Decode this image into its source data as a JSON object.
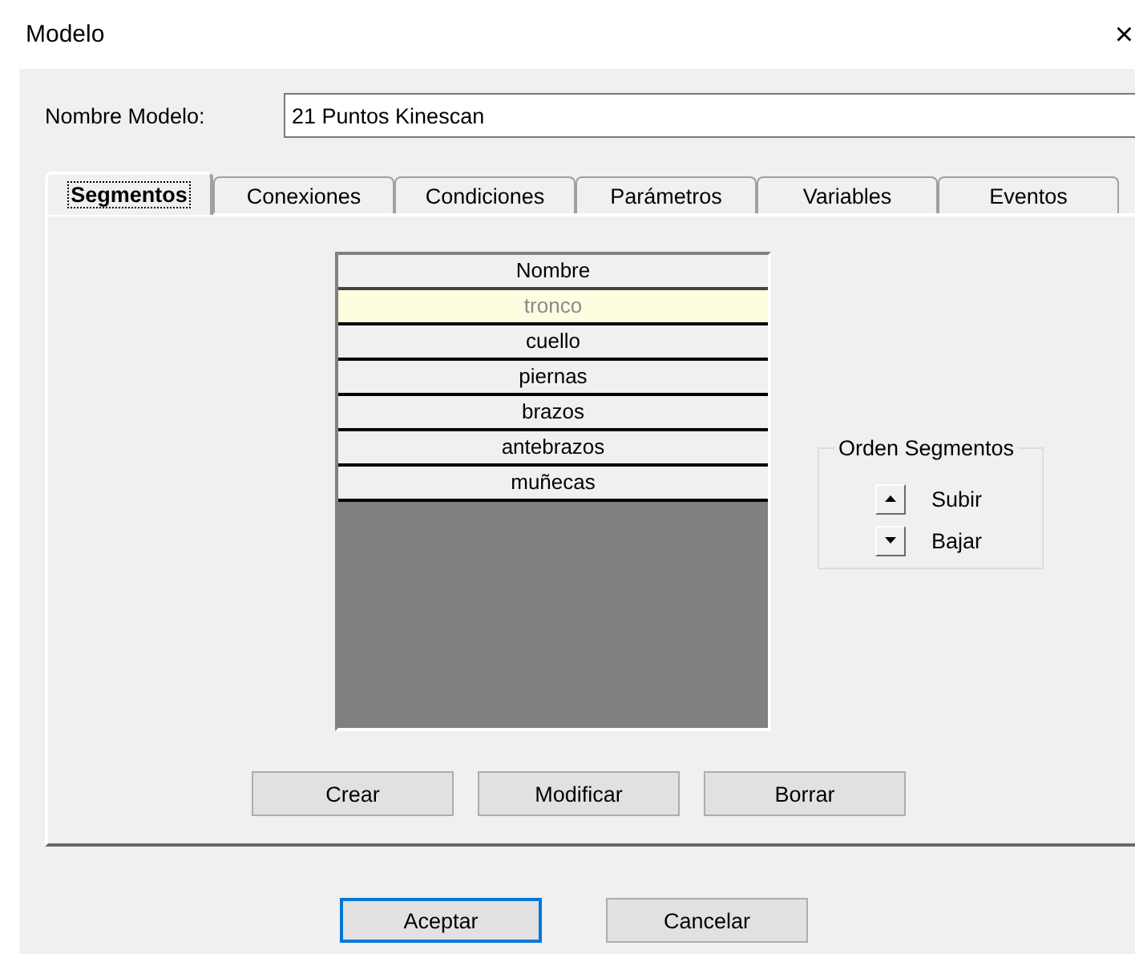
{
  "window": {
    "title": "Modelo",
    "close": "×"
  },
  "name_field": {
    "label": "Nombre Modelo:",
    "value": "21 Puntos Kinescan"
  },
  "tabs": [
    {
      "label": "Segmentos",
      "selected": true
    },
    {
      "label": "Conexiones",
      "selected": false
    },
    {
      "label": "Condiciones",
      "selected": false
    },
    {
      "label": "Parámetros",
      "selected": false
    },
    {
      "label": "Variables",
      "selected": false
    },
    {
      "label": "Eventos",
      "selected": false
    }
  ],
  "table": {
    "columns": [
      "Nombre"
    ],
    "rows": [
      {
        "cells": [
          "tronco"
        ],
        "selected": true
      },
      {
        "cells": [
          "cuello"
        ],
        "selected": false
      },
      {
        "cells": [
          "piernas"
        ],
        "selected": false
      },
      {
        "cells": [
          "brazos"
        ],
        "selected": false
      },
      {
        "cells": [
          "antebrazos"
        ],
        "selected": false
      },
      {
        "cells": [
          "muñecas"
        ],
        "selected": false
      }
    ]
  },
  "order_group": {
    "title": "Orden Segmentos",
    "items": [
      {
        "kind": "up",
        "label": "Subir"
      },
      {
        "kind": "down",
        "label": "Bajar"
      }
    ]
  },
  "tab_buttons": [
    {
      "label": "Crear",
      "default": false
    },
    {
      "label": "Modificar",
      "default": false
    },
    {
      "label": "Borrar",
      "default": false
    }
  ],
  "dialog_buttons": [
    {
      "label": "Aceptar",
      "default": true
    },
    {
      "label": "Cancelar",
      "default": false
    }
  ]
}
